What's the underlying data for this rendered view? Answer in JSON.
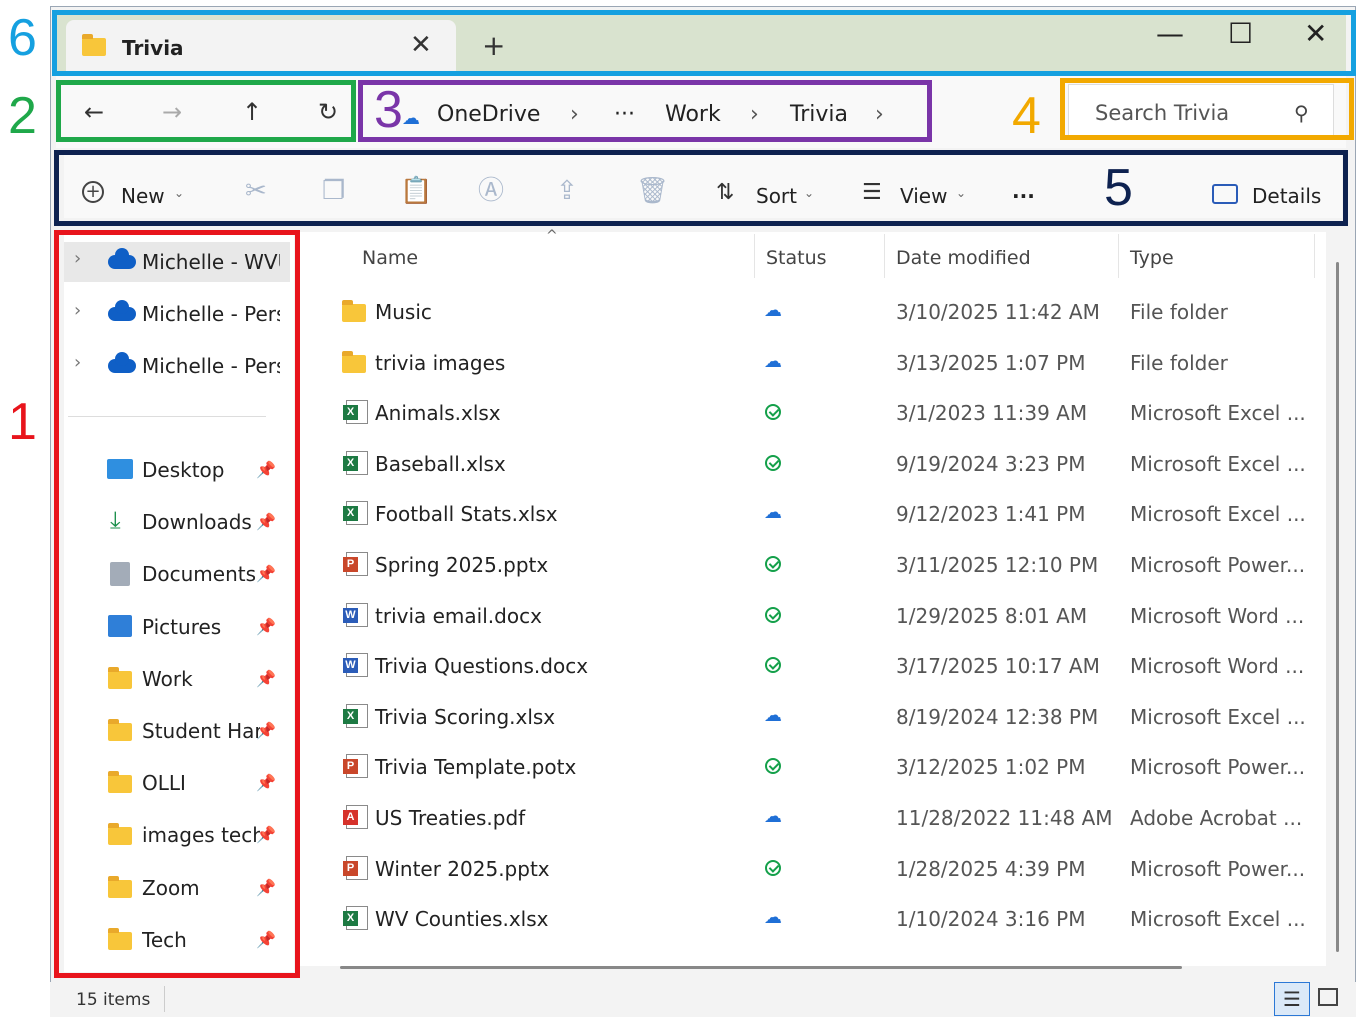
{
  "window": {
    "tab_title": "Trivia"
  },
  "nav": {
    "back": "←",
    "forward": "→",
    "up": "↑",
    "refresh": "↻"
  },
  "breadcrumb": {
    "items": [
      "OneDrive",
      "Work",
      "Trivia"
    ],
    "ellipsis": "···"
  },
  "search": {
    "placeholder": "Search Trivia"
  },
  "toolbar": {
    "new_label": "New",
    "sort_label": "Sort",
    "view_label": "View",
    "more_label": "···",
    "details_label": "Details"
  },
  "sidebar": {
    "accounts": [
      "Michelle - WVU",
      "Michelle - Pers",
      "Michelle - Pers"
    ],
    "quick": [
      {
        "label": "Desktop",
        "icon": "desktop-icon"
      },
      {
        "label": "Downloads",
        "icon": "download-icon"
      },
      {
        "label": "Documents",
        "icon": "documents-icon"
      },
      {
        "label": "Pictures",
        "icon": "pictures-icon"
      },
      {
        "label": "Work",
        "icon": "folder-icon"
      },
      {
        "label": "Student Har",
        "icon": "folder-icon"
      },
      {
        "label": "OLLI",
        "icon": "folder-icon"
      },
      {
        "label": "images tech",
        "icon": "folder-icon"
      },
      {
        "label": "Zoom",
        "icon": "folder-icon"
      },
      {
        "label": "Tech",
        "icon": "folder-icon"
      }
    ]
  },
  "table": {
    "columns": [
      "Name",
      "Status",
      "Date modified",
      "Type"
    ],
    "rows": [
      {
        "name": "Music",
        "kind": "folder",
        "status": "cloud",
        "date": "3/10/2025 11:42 AM",
        "type": "File folder"
      },
      {
        "name": "trivia images",
        "kind": "folder",
        "status": "cloud",
        "date": "3/13/2025 1:07 PM",
        "type": "File folder"
      },
      {
        "name": "Animals.xlsx",
        "kind": "excel",
        "status": "synced",
        "date": "3/1/2023 11:39 AM",
        "type": "Microsoft Excel ..."
      },
      {
        "name": "Baseball.xlsx",
        "kind": "excel",
        "status": "synced",
        "date": "9/19/2024 3:23 PM",
        "type": "Microsoft Excel ..."
      },
      {
        "name": "Football Stats.xlsx",
        "kind": "excel",
        "status": "cloud",
        "date": "9/12/2023 1:41 PM",
        "type": "Microsoft Excel ..."
      },
      {
        "name": "Spring 2025.pptx",
        "kind": "ppt",
        "status": "synced",
        "date": "3/11/2025 12:10 PM",
        "type": "Microsoft Power..."
      },
      {
        "name": "trivia email.docx",
        "kind": "word",
        "status": "synced",
        "date": "1/29/2025 8:01 AM",
        "type": "Microsoft Word ..."
      },
      {
        "name": "Trivia Questions.docx",
        "kind": "word",
        "status": "synced",
        "date": "3/17/2025 10:17 AM",
        "type": "Microsoft Word ..."
      },
      {
        "name": "Trivia Scoring.xlsx",
        "kind": "excel",
        "status": "cloud",
        "date": "8/19/2024 12:38 PM",
        "type": "Microsoft Excel ..."
      },
      {
        "name": "Trivia Template.potx",
        "kind": "ppt",
        "status": "synced",
        "date": "3/12/2025 1:02 PM",
        "type": "Microsoft Power..."
      },
      {
        "name": "US Treaties.pdf",
        "kind": "pdf",
        "status": "cloud",
        "date": "11/28/2022 11:48 AM",
        "type": "Adobe Acrobat ..."
      },
      {
        "name": "Winter 2025.pptx",
        "kind": "ppt",
        "status": "synced",
        "date": "1/28/2025 4:39 PM",
        "type": "Microsoft Power..."
      },
      {
        "name": "WV Counties.xlsx",
        "kind": "excel",
        "status": "cloud",
        "date": "1/10/2024 3:16 PM",
        "type": "Microsoft Excel ..."
      }
    ]
  },
  "statusbar": {
    "count": "15 items"
  },
  "annotations": [
    {
      "label": "1",
      "color": "#e8141c"
    },
    {
      "label": "2",
      "color": "#1fa84a"
    },
    {
      "label": "3",
      "color": "#7a35a8"
    },
    {
      "label": "4",
      "color": "#f2a900"
    },
    {
      "label": "5",
      "color": "#0e2250"
    },
    {
      "label": "6",
      "color": "#15a0e0"
    }
  ],
  "colors": {
    "excel": "#1d7a43",
    "word": "#2b5cb8",
    "ppt": "#c9472a",
    "pdf": "#d6322b"
  }
}
